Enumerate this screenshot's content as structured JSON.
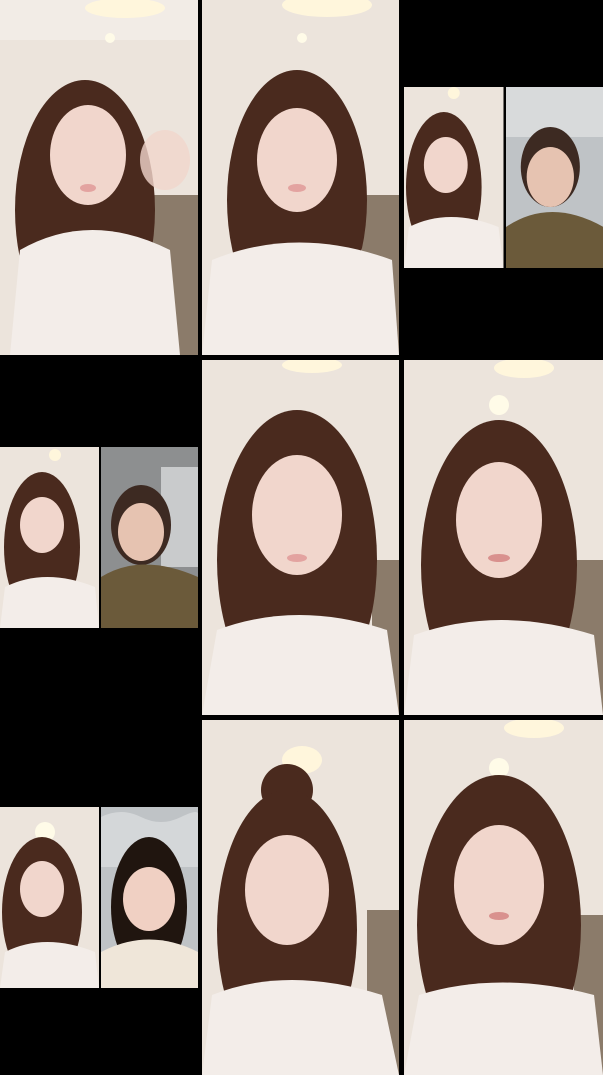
{
  "grid": {
    "rows": 3,
    "cols": 3,
    "tiles": [
      {
        "id": "t00",
        "kind": "single"
      },
      {
        "id": "t01",
        "kind": "single"
      },
      {
        "id": "t02",
        "kind": "split"
      },
      {
        "id": "t10",
        "kind": "split"
      },
      {
        "id": "t11",
        "kind": "single"
      },
      {
        "id": "t12",
        "kind": "single"
      },
      {
        "id": "t20",
        "kind": "split"
      },
      {
        "id": "t21",
        "kind": "single"
      },
      {
        "id": "t22",
        "kind": "single"
      }
    ]
  },
  "colors": {
    "background": "#000000",
    "wall": "#ece4dc",
    "ceiling_light": "#fff6dc",
    "hair": "#4a2a1e",
    "skin": "#f1d6cc",
    "shirt": "#f3ede9",
    "sofa": "#8b7b6a",
    "sweater": "#6b5a3a"
  }
}
